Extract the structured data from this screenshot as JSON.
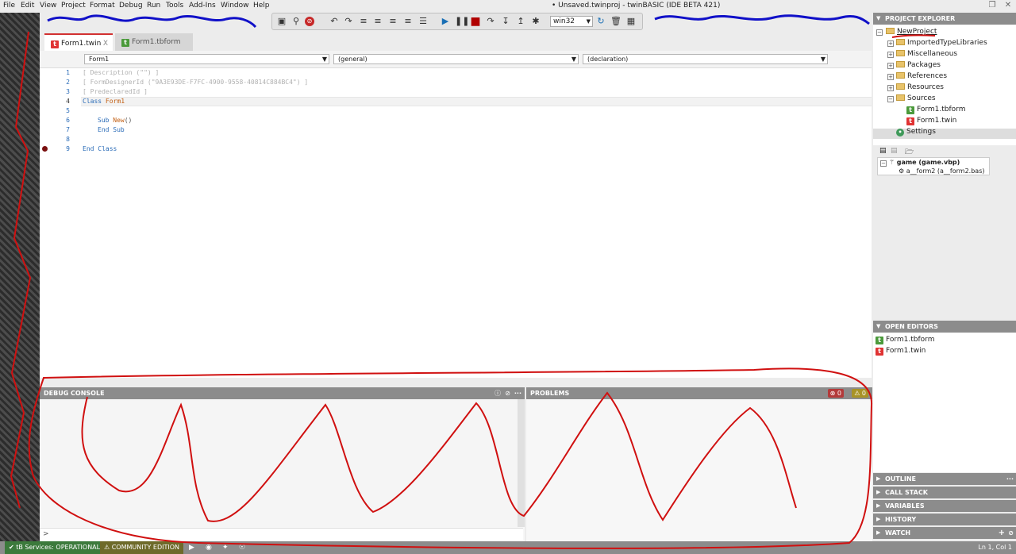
{
  "menu": [
    "File",
    "Edit",
    "View",
    "Project",
    "Format",
    "Debug",
    "Run",
    "Tools",
    "Add-Ins",
    "Window",
    "Help"
  ],
  "window": {
    "title": "• Unsaved.twinproj - twinBASIC (IDE BETA 421)",
    "restore_icon": "restore-icon",
    "close_icon": "close-icon"
  },
  "toolbar": {
    "target": "win32",
    "icons": [
      "save-icon",
      "find-icon",
      "stop-sign-icon",
      "undo-icon",
      "redo-icon",
      "indent-icon",
      "outdent-icon",
      "comment-icon",
      "uncomment-icon",
      "list-icon",
      "run-icon",
      "pause-icon",
      "stop-icon",
      "step-over-icon",
      "step-into-icon",
      "step-out-icon",
      "breakpoint-icon",
      "refresh-icon",
      "delete-icon",
      "grid-icon"
    ]
  },
  "tabs": [
    {
      "label": "Form1.twin",
      "close": "X"
    },
    {
      "label": "Form1.tbform"
    }
  ],
  "codebar": {
    "object": "Form1",
    "proc": "(general)",
    "decl": "(declaration)"
  },
  "code": {
    "line_numbers": [
      "1",
      "2",
      "3",
      "4",
      "5",
      "6",
      "7",
      "8",
      "9"
    ],
    "lines": {
      "l1": "[ Description (\"\") ]",
      "l2": "[ FormDesignerId (\"9A3E93DE-F7FC-4900-9558-40814C884BC4\") ]",
      "l3": "[ PredeclaredId ]",
      "l4_kw": "Class",
      "l4_name": "Form1",
      "l6_kw": "Sub",
      "l6_name": "New",
      "l6_paren": "()",
      "l7": "End Sub",
      "l9": "End Class"
    }
  },
  "debug": {
    "title": "DEBUG CONSOLE",
    "prompt": ">"
  },
  "problems": {
    "title": "PROBLEMS",
    "errors": "0",
    "warnings": "0"
  },
  "explorer": {
    "title": "PROJECT EXPLORER",
    "root": "NewProject",
    "items": [
      "ImportedTypeLibraries",
      "Miscellaneous",
      "Packages",
      "References",
      "Resources",
      "Sources",
      "Form1.tbform",
      "Form1.twin",
      "Settings"
    ]
  },
  "vbp": {
    "project": "game (game.vbp)",
    "module": "a__form2 (a__form2.bas)"
  },
  "open_editors": {
    "title": "OPEN EDITORS",
    "items": [
      "Form1.tbform",
      "Form1.twin"
    ]
  },
  "side_panels": [
    "OUTLINE",
    "CALL STACK",
    "VARIABLES",
    "HISTORY",
    "WATCH"
  ],
  "status": {
    "services": "tB Services: OPERATIONAL",
    "edition": "COMMUNITY EDITION",
    "position": "Ln 1, Col 1"
  }
}
